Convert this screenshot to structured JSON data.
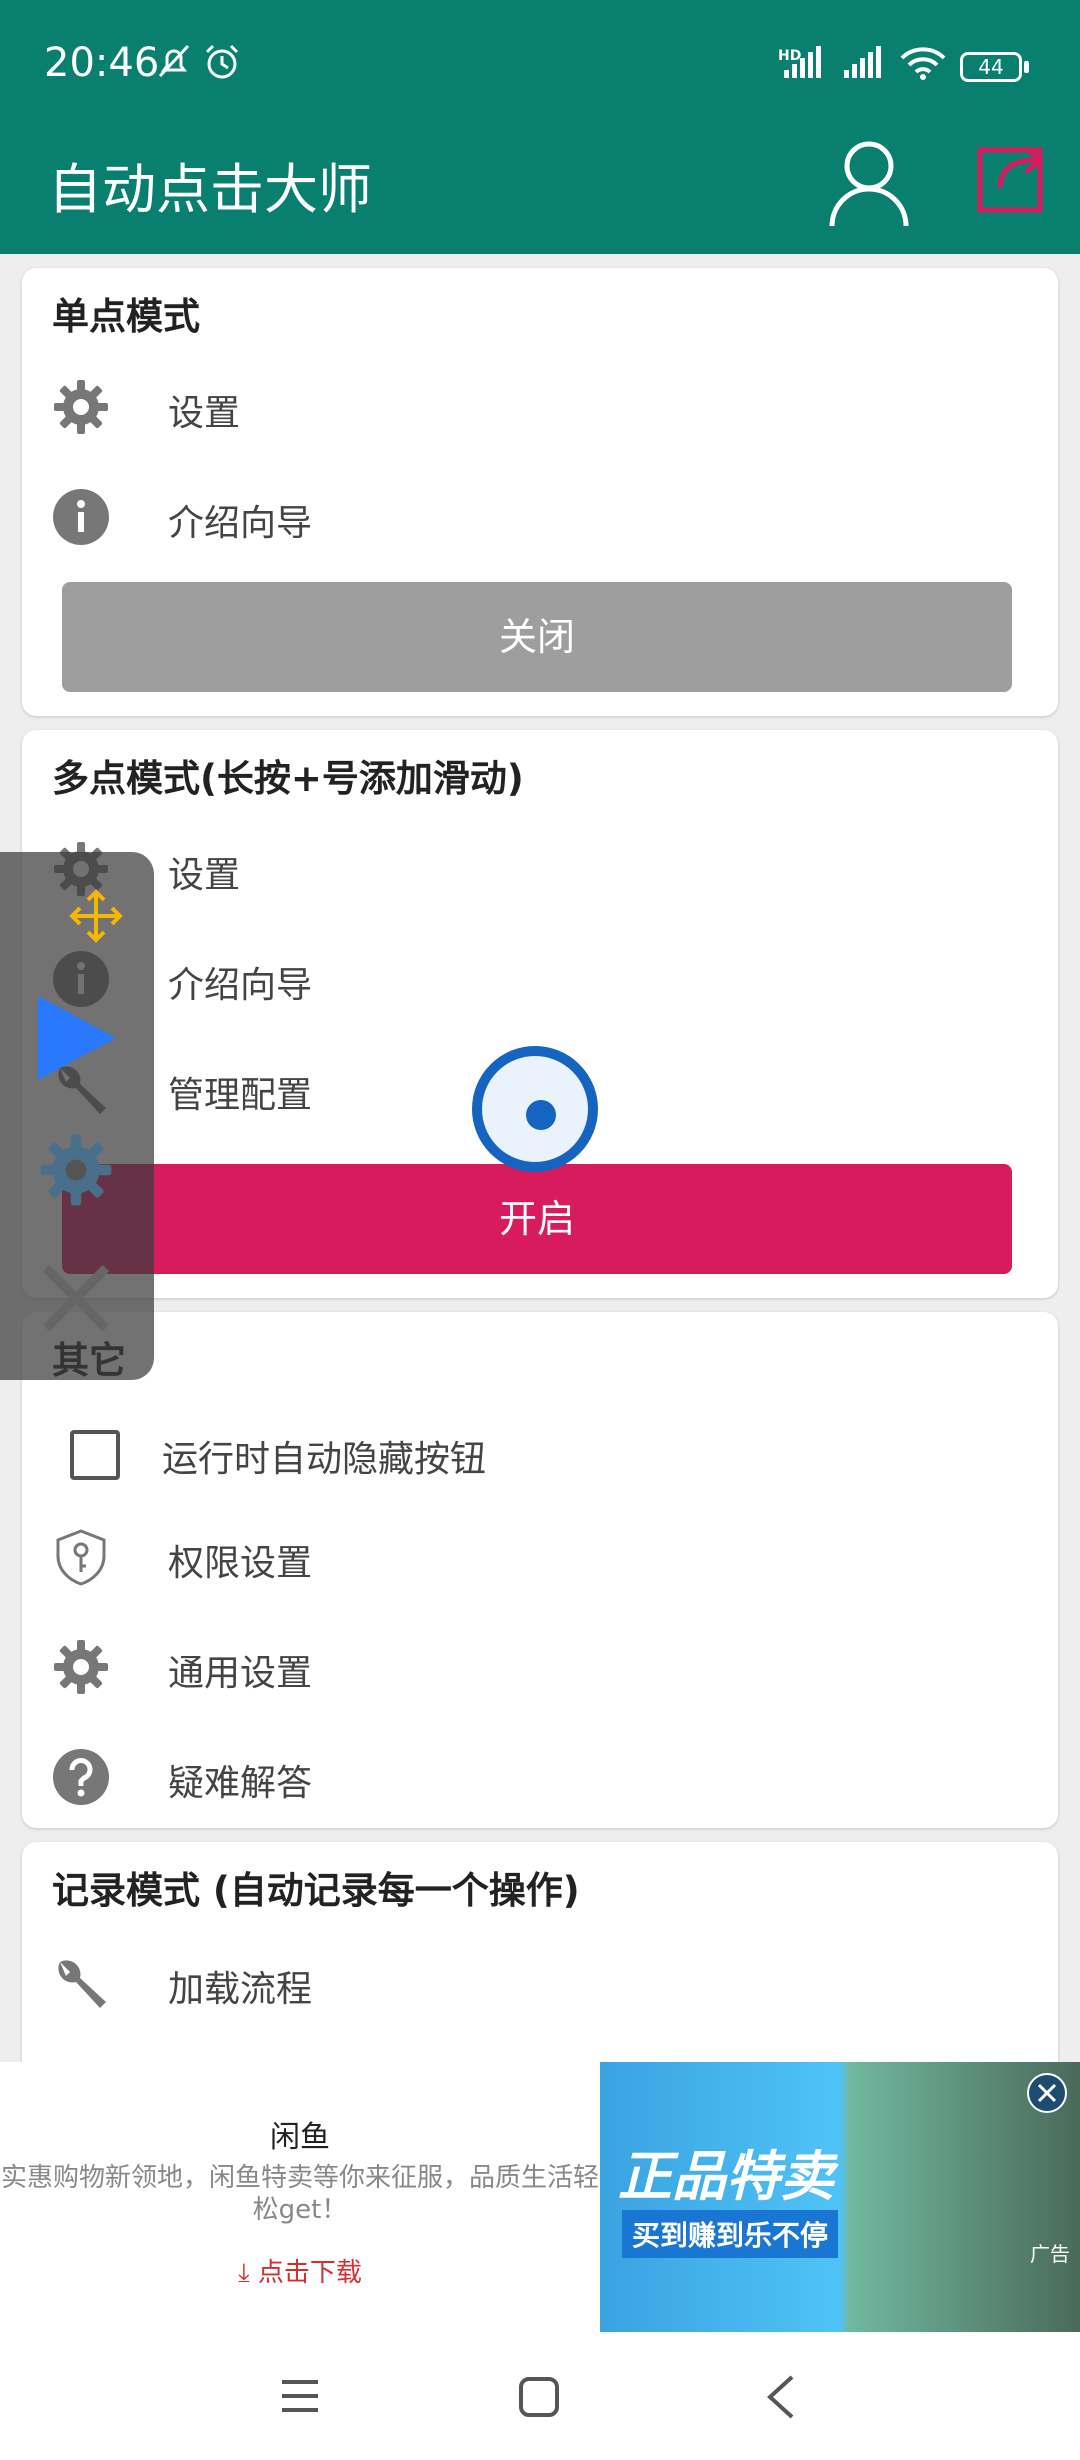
{
  "status_bar": {
    "time": "20:46",
    "battery": "44",
    "network_label": "HD"
  },
  "app_bar": {
    "title": "自动点击大师"
  },
  "single_mode": {
    "title": "单点模式",
    "settings": "设置",
    "guide": "介绍向导",
    "button": "关闭"
  },
  "multi_mode": {
    "title": "多点模式(长按+号添加滑动)",
    "settings": "设置",
    "guide": "介绍向导",
    "manage": "管理配置",
    "button": "开启"
  },
  "other": {
    "title": "其它",
    "auto_hide": "运行时自动隐藏按钮",
    "permissions": "权限设置",
    "general": "通用设置",
    "faq": "疑难解答"
  },
  "record_mode": {
    "title": "记录模式 (自动记录每一个操作)",
    "load": "加载流程"
  },
  "ad": {
    "title": "闲鱼",
    "description": "实惠购物新领地，闲鱼特卖等你来征服，品质生活轻松get！",
    "link": "点击下载",
    "banner_main": "正品特卖",
    "banner_sub": "买到赚到乐不停",
    "tag": "广告"
  },
  "colors": {
    "primary": "#087f6f",
    "accent_pink": "#d81b5d",
    "gray_button": "#9e9e9e",
    "target_blue": "#1565c0"
  }
}
